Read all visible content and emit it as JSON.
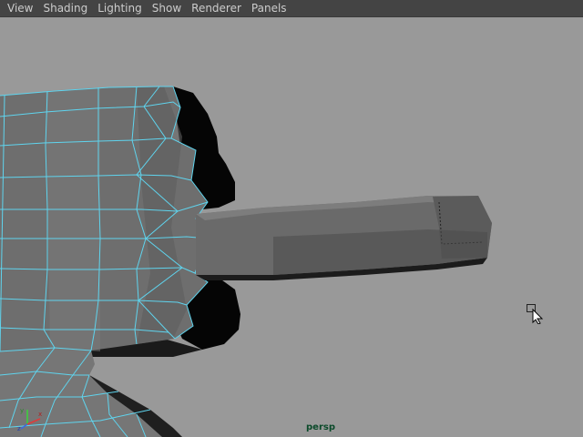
{
  "menubar": {
    "items": [
      {
        "label": "View"
      },
      {
        "label": "Shading"
      },
      {
        "label": "Lighting"
      },
      {
        "label": "Show"
      },
      {
        "label": "Renderer"
      },
      {
        "label": "Panels"
      }
    ]
  },
  "viewport": {
    "camera_label": "persp",
    "background_color": "#999999",
    "wireframe_color": "#5fd4ee",
    "axis_x_color": "#e03a3a",
    "axis_y_color": "#3ad43a",
    "axis_z_color": "#3a6ae0"
  }
}
